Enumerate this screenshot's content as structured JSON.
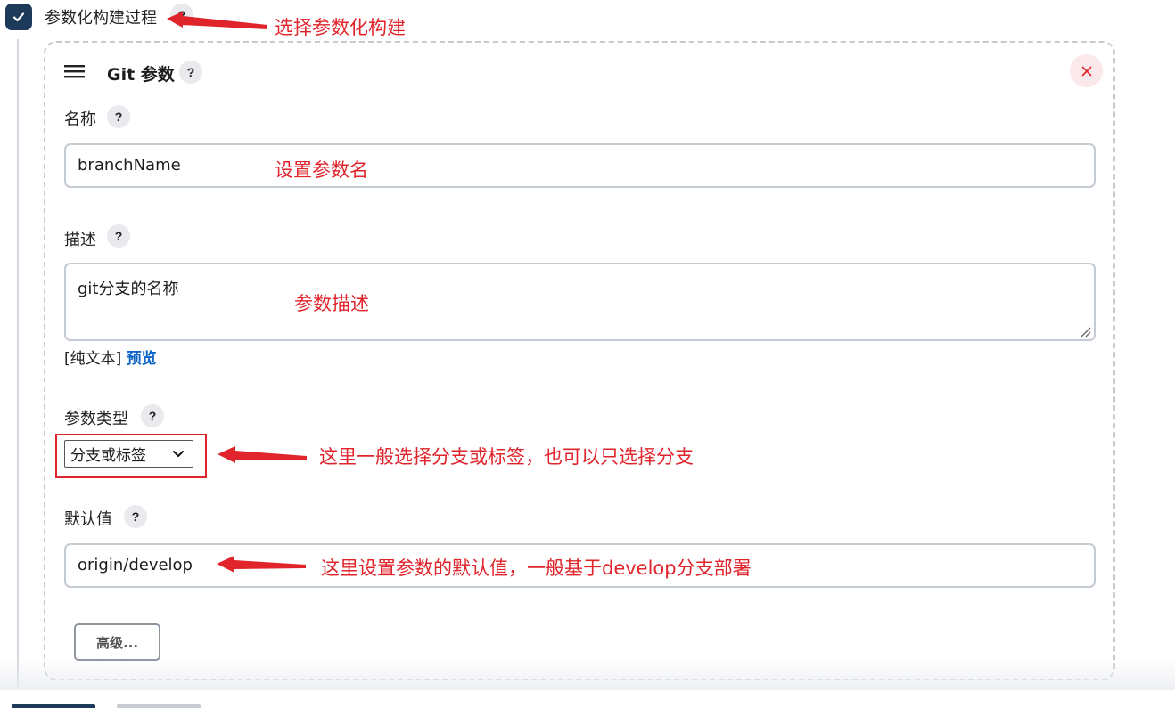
{
  "section": {
    "checkbox_checked": true,
    "label": "参数化构建过程",
    "help": "?"
  },
  "parameter": {
    "title": "Git 参数",
    "help": "?",
    "name_label": "名称",
    "name_value": "branchName",
    "desc_label": "描述",
    "desc_value": "git分支的名称",
    "format_plain": "[纯文本]",
    "format_preview": "预览",
    "type_label": "参数类型",
    "type_value": "分支或标签",
    "default_label": "默认值",
    "default_value": "origin/develop",
    "advanced_button": "高级..."
  },
  "annotations": {
    "a1": "选择参数化构建",
    "a2": "设置参数名",
    "a3": "参数描述",
    "a4": "这里一般选择分支或标签，也可以只选择分支",
    "a5": "这里设置参数的默认值，一般基于develop分支部署"
  },
  "colors": {
    "annotation": "#e0242b",
    "checkbox": "#1e3a5a",
    "link": "#0b63c5"
  }
}
